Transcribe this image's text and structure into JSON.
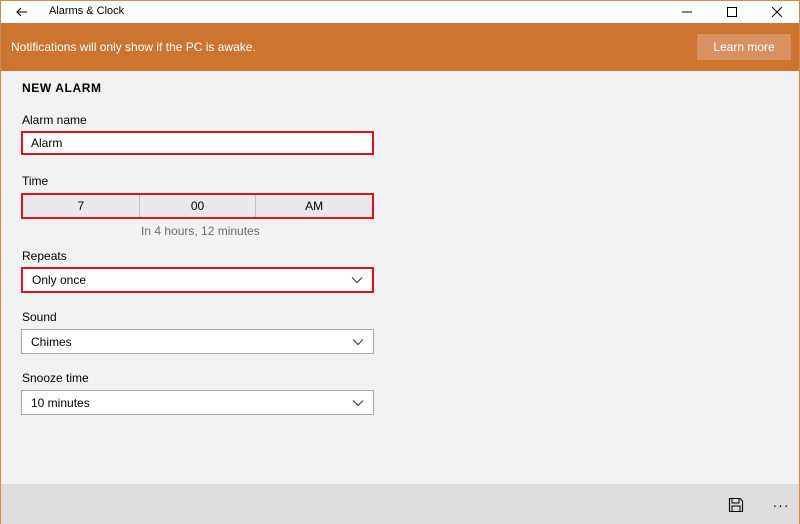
{
  "app": {
    "title": "Alarms & Clock"
  },
  "window_controls": {
    "minimize": "minimize-icon",
    "maximize": "maximize-icon",
    "close": "close-icon"
  },
  "banner": {
    "message": "Notifications will only show if the PC is awake.",
    "button_label": "Learn more",
    "color": "#cd742e"
  },
  "form": {
    "heading": "NEW ALARM",
    "alarm_name": {
      "label": "Alarm name",
      "value": "Alarm"
    },
    "time": {
      "label": "Time",
      "hour": "7",
      "minute": "00",
      "period": "AM",
      "hint": "In 4 hours, 12 minutes"
    },
    "repeats": {
      "label": "Repeats",
      "value": "Only once"
    },
    "sound": {
      "label": "Sound",
      "value": "Chimes"
    },
    "snooze": {
      "label": "Snooze time",
      "value": "10 minutes"
    }
  },
  "bottombar": {
    "save_icon": "save-icon",
    "more_label": "···"
  },
  "colors": {
    "highlight_border": "#e0131d",
    "accent": "#cd742e"
  }
}
